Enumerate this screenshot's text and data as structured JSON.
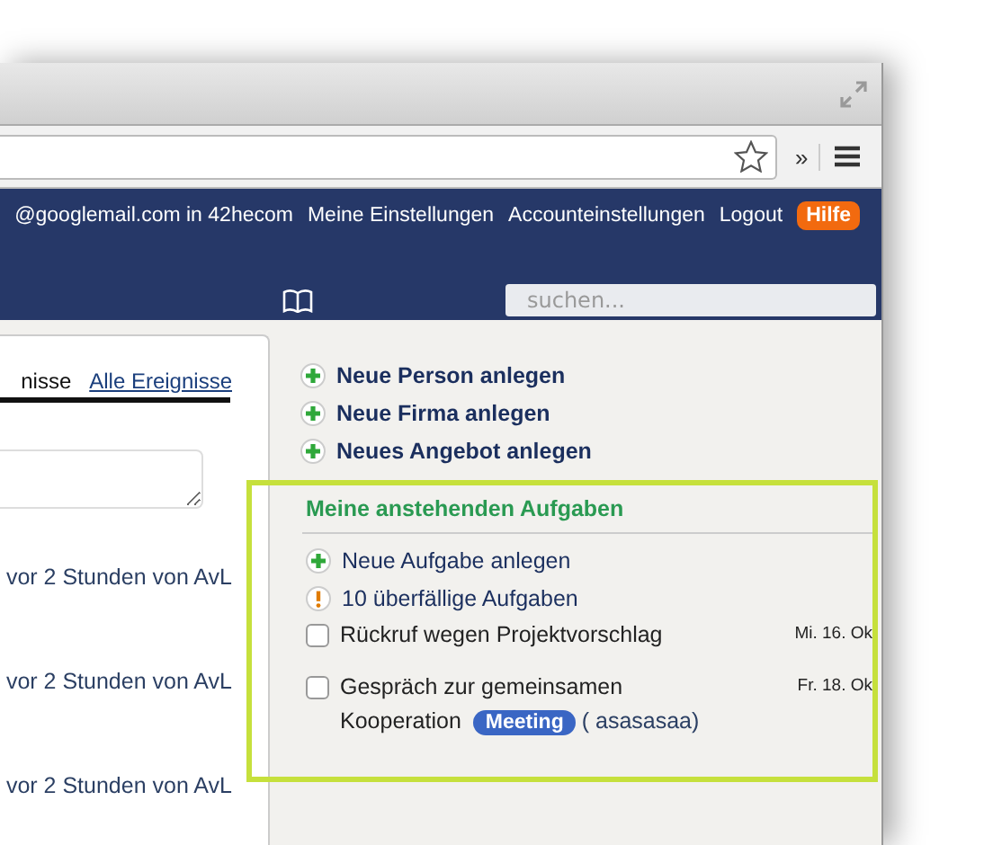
{
  "toolbar": {
    "overflow": "»"
  },
  "header": {
    "account": "@googlemail.com in 42hecom",
    "links": [
      "Meine Einstellungen",
      "Accounteinstellungen",
      "Logout"
    ],
    "help": "Hilfe"
  },
  "search": {
    "placeholder": "suchen..."
  },
  "events": {
    "tabs": [
      {
        "label": "nisse",
        "selected": true
      },
      {
        "label": "Alle Ereignisse",
        "selected": false
      }
    ],
    "entries": [
      "vor 2 Stunden von AvL",
      "vor 2 Stunden von AvL",
      "vor 2 Stunden von AvL"
    ]
  },
  "actions": [
    "Neue Person anlegen",
    "Neue Firma anlegen",
    "Neues Angebot anlegen"
  ],
  "tasks": {
    "title": "Meine anstehenden Aufgaben",
    "items": [
      {
        "kind": "add",
        "label": "Neue Aufgabe anlegen"
      },
      {
        "kind": "alert",
        "label": "10 überfällige Aufgaben"
      },
      {
        "kind": "todo",
        "lines": [
          "Rückruf wegen Projektvorschlag"
        ],
        "checked": false,
        "date": "Mi. 16. Ok"
      },
      {
        "kind": "todo",
        "lines": [
          "Gespräch zur gemeinsamen",
          "Kooperation"
        ],
        "checked": false,
        "date": "Fr. 18. Ok",
        "tag": "Meeting",
        "note": "( asasasaa)"
      }
    ]
  }
}
